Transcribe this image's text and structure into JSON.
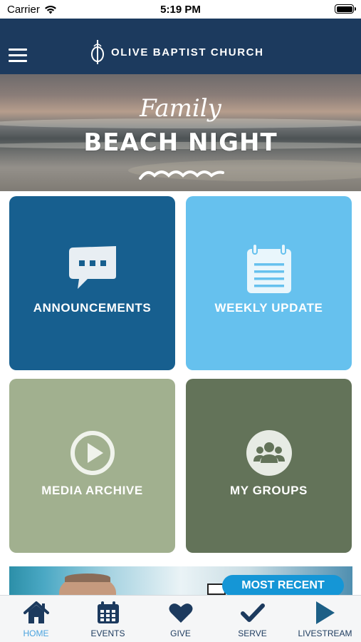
{
  "status_bar": {
    "carrier": "Carrier",
    "time": "5:19 PM"
  },
  "header": {
    "title": "OLIVE BAPTIST CHURCH",
    "menu_icon": "hamburger-menu-icon"
  },
  "banner": {
    "script_text": "Family",
    "title": "BEACH NIGHT"
  },
  "tiles": [
    {
      "label": "ANNOUNCEMENTS",
      "icon": "chat-bubble-icon",
      "color": "#175f8f"
    },
    {
      "label": "WEEKLY UPDATE",
      "icon": "notepad-icon",
      "color": "#66c1ee"
    },
    {
      "label": "MEDIA ARCHIVE",
      "icon": "play-circle-icon",
      "color": "#a1b08f"
    },
    {
      "label": "MY GROUPS",
      "icon": "group-icon",
      "color": "#637359"
    }
  ],
  "most_recent": {
    "badge": "MOST RECENT"
  },
  "tabs": [
    {
      "label": "HOME",
      "icon": "home-icon",
      "active": true
    },
    {
      "label": "EVENTS",
      "icon": "calendar-icon"
    },
    {
      "label": "GIVE",
      "icon": "heart-icon"
    },
    {
      "label": "SERVE",
      "icon": "checkmark-icon"
    },
    {
      "label": "LIVESTREAM",
      "icon": "play-icon"
    }
  ],
  "colors": {
    "header_bg": "#1c3a5e",
    "accent": "#1596d6",
    "tab_active": "#4aa3df",
    "tab_inactive": "#1c3a5e"
  }
}
